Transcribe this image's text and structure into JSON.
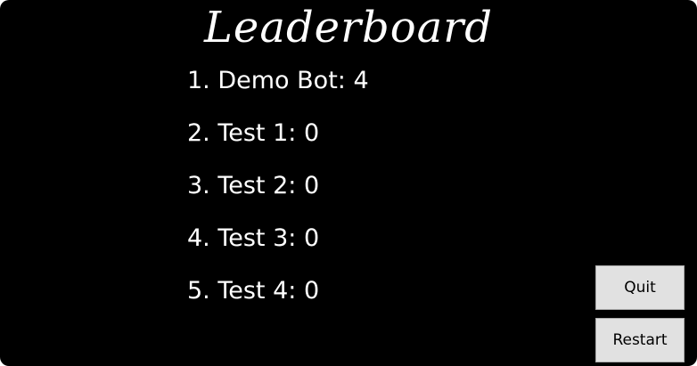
{
  "header": {
    "title": "Leaderboard"
  },
  "leaderboard": {
    "entries": [
      "1. Demo Bot: 4",
      "2. Test 1: 0",
      "3. Test 2: 0",
      "4. Test 3: 0",
      "5. Test 4: 0"
    ]
  },
  "buttons": {
    "quit_label": "Quit",
    "restart_label": "Restart"
  },
  "colors": {
    "background": "#000000",
    "text": "#ffffff",
    "button_face": "#e1e1e1"
  }
}
